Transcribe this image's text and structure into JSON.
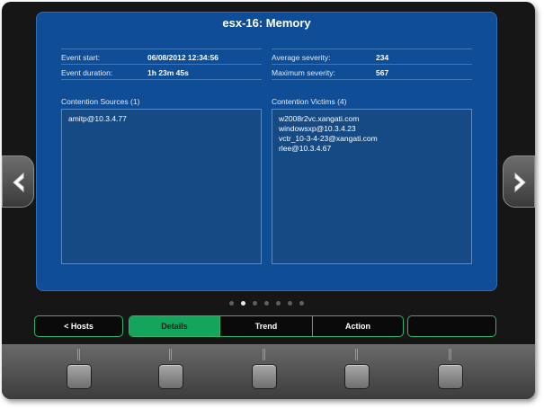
{
  "title": "esx-16: Memory",
  "event": {
    "start_label": "Event start:",
    "start_value": "06/08/2012 12:34:56",
    "duration_label": "Event duration:",
    "duration_value": "1h 23m 45s",
    "avg_severity_label": "Average severity:",
    "avg_severity_value": "234",
    "max_severity_label": "Maximum severity:",
    "max_severity_value": "567"
  },
  "sources": {
    "label": "Contention Sources (1)",
    "items": [
      "amitp@10.3.4.77"
    ]
  },
  "victims": {
    "label": "Contention Victims (4)",
    "items": [
      "w2008r2vc.xangati.com",
      "windowsxp@10.3.4.23",
      "vctr_10-3-4-23@xangati.com",
      "rlee@10.3.4.67"
    ]
  },
  "pager": {
    "total": 7,
    "active": 1
  },
  "nav": {
    "hosts_label": "< Hosts",
    "details_label": "Details",
    "trend_label": "Trend",
    "action_label": "Action",
    "empty_label": ""
  },
  "icons": {
    "left": "chevron-left-icon",
    "right": "chevron-right-icon"
  },
  "colors": {
    "panel": "#0f4d96",
    "accent_green": "#14a45c"
  }
}
